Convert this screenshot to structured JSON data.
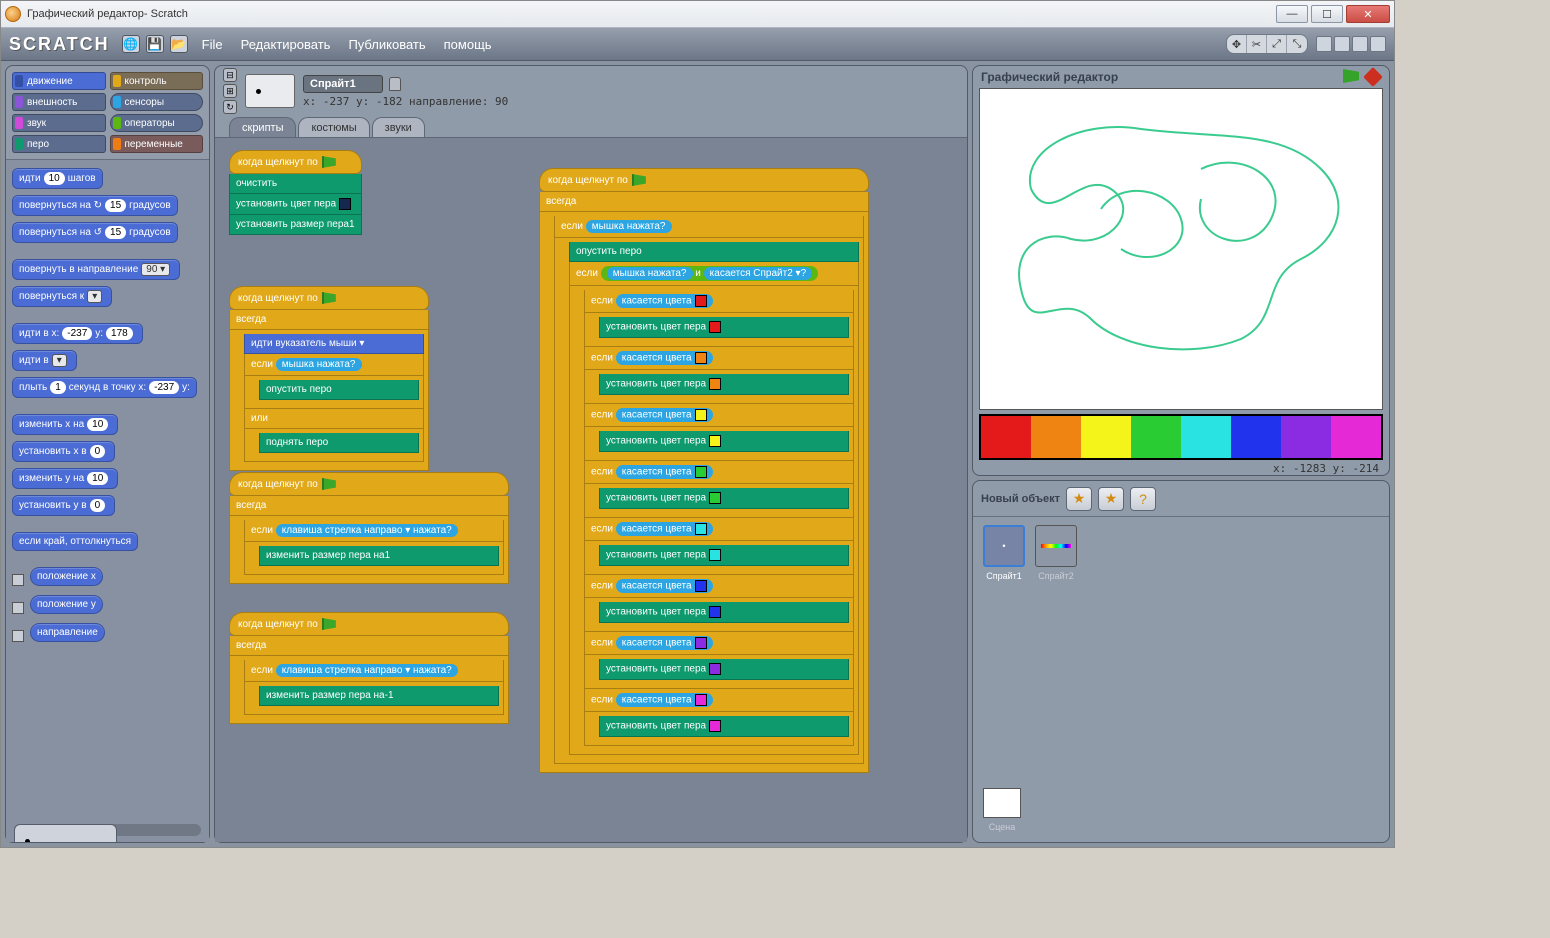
{
  "window": {
    "title": "Графический редактор- Scratch"
  },
  "toolbar": {
    "logo": "SCRATCH",
    "menu": {
      "file": "File",
      "edit": "Редактировать",
      "share": "Публиковать",
      "help": "помощь"
    }
  },
  "categories": {
    "motion": "движение",
    "looks": "внешность",
    "sound": "звук",
    "pen": "перо",
    "control": "контроль",
    "sensing": "сенсоры",
    "operators": "операторы",
    "variables": "переменные"
  },
  "palette_blocks": {
    "b1_pre": "идти",
    "b1_arg": "10",
    "b1_post": "шагов",
    "b2_pre": "повернуться на ↻",
    "b2_arg": "15",
    "b2_post": "градусов",
    "b3_pre": "повернуться на ↺",
    "b3_arg": "15",
    "b3_post": "градусов",
    "b4_pre": "повернуть в направление",
    "b4_arg": "90 ▾",
    "b5": "повернуться к",
    "b5_arg": " ▾",
    "b6_pre": "идти в x:",
    "b6_a1": "-237",
    "b6_mid": "y:",
    "b6_a2": "178",
    "b7": "идти в",
    "b7_arg": " ▾",
    "b8_pre": "плыть",
    "b8_a1": "1",
    "b8_mid": "секунд в точку x:",
    "b8_a2": "-237",
    "b8_post": "y:",
    "b9_pre": "изменить x на",
    "b9_arg": "10",
    "b10_pre": "установить x в",
    "b10_arg": "0",
    "b11_pre": "изменить y на",
    "b11_arg": "10",
    "b12_pre": "установить y в",
    "b12_arg": "0",
    "b13": "если край, оттолкнуться",
    "r1": "положение x",
    "r2": "положение y",
    "r3": "направление"
  },
  "sprite": {
    "name": "Спрайт1",
    "info": "x: -237 y: -182 направление: 90",
    "tabs": {
      "scripts": "скрипты",
      "costumes": "костюмы",
      "sounds": "звуки"
    }
  },
  "scripts": {
    "hat": "когда щелкнут по",
    "clear": "очистить",
    "setpencolor": "установить цвет пера",
    "setpensize": "установить размер пера",
    "setpensize_arg": "1",
    "forever": "всегда",
    "goto_mouse": "идти в",
    "goto_mouse_arg": "указатель мыши ▾",
    "if": "если",
    "mousedown": "мышка нажата?",
    "pendown": "опустить перо",
    "else": "или",
    "penup": "поднять перо",
    "key_right_pre": "клавиша",
    "key_right_arg": "стрелка направо ▾",
    "key_right_post": "нажата?",
    "changepensize": "изменить размер пера на",
    "changepensize_arg1": "1",
    "changepensize_arg2": "-1",
    "and": "и",
    "touching": "касается",
    "touching_arg": "Спрайт2 ▾",
    "touching_q": "?",
    "touchingcolor": "касается цвета",
    "colors": {
      "red": "#e41a1a",
      "orange": "#ef8412",
      "yellow": "#f4f41a",
      "green": "#29cc33",
      "cyan": "#29e3e3",
      "blue": "#2233ee",
      "purple": "#8b2be2",
      "magenta": "#e629d6",
      "darknav": "#142850"
    }
  },
  "stage": {
    "title": "Графический редактор",
    "coords": "x: -1283 y: -214",
    "new_object": "Новый объект",
    "stage_label": "Сцена",
    "sprites": {
      "s1": "Спрайт1",
      "s2": "Спрайт2"
    }
  }
}
